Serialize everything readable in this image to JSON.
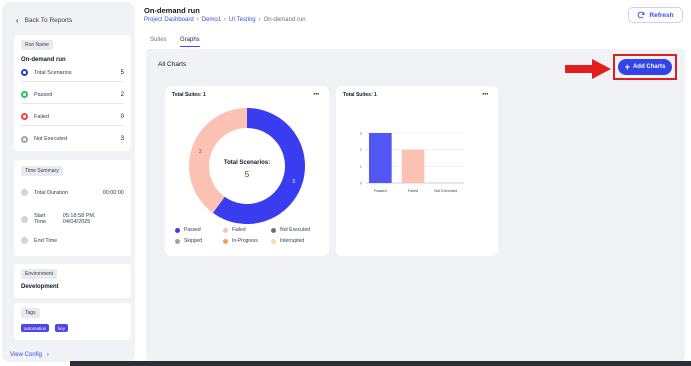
{
  "sidebar": {
    "back_label": "Back To Reports",
    "run_name_chip": "Run Name",
    "run_name": "On-demand run",
    "stats": [
      {
        "label": "Total Scenarios",
        "count": "5",
        "color": "#2b3bd6"
      },
      {
        "label": "Passed",
        "count": "2",
        "color": "#22c55e"
      },
      {
        "label": "Failed",
        "count": "0",
        "color": "#ef4444"
      },
      {
        "label": "Not Executed",
        "count": "3",
        "color": "#9ca3af"
      }
    ],
    "time_chip": "Time Summary",
    "times": [
      {
        "label": "Total Duration",
        "value": "00:00:00"
      },
      {
        "label": "Start Time",
        "value": "05:18:58 PM, 04/04/2025"
      },
      {
        "label": "End Time",
        "value": ""
      }
    ],
    "env_chip": "Environment",
    "env_value": "Development",
    "tags_chip": "Tags",
    "tags": [
      "automation",
      "key"
    ],
    "view_config": "View Config"
  },
  "header": {
    "title": "On-demand run",
    "breadcrumbs": [
      "Project Dashboard",
      "Demo1",
      "UI Testing",
      "On-demand run"
    ],
    "refresh_label": "Refresh"
  },
  "tabs": [
    "Suites",
    "Graphs"
  ],
  "main": {
    "all_charts": "All Charts",
    "add_charts": "Add Charts"
  },
  "colors": {
    "passed": "#3a3cf0",
    "failed": "#fbc2b4",
    "not_executed": "#6b7280",
    "skipped": "#9ca3af",
    "in_progress": "#f59e5b",
    "interrupted": "#fcd9a5",
    "bar_passed": "#5156f5",
    "bar_failed": "#fbc2b4"
  },
  "chart_data": [
    {
      "type": "pie",
      "title": "Total Suites: 1",
      "center_label": "Total Scenarios:",
      "center_value": "5",
      "categories": [
        "Passed",
        "Failed",
        "Not Executed",
        "Skipped",
        "In-Progress",
        "Interrupted"
      ],
      "values": [
        3,
        2,
        0,
        0,
        0,
        0
      ],
      "slice_labels": [
        "3",
        "2"
      ],
      "legend_placement": "bottom"
    },
    {
      "type": "bar",
      "title": "Total Suites: 1",
      "categories": [
        "Passed",
        "Failed",
        "Not Executed"
      ],
      "values": [
        3,
        2,
        0
      ],
      "ylim": [
        0,
        3
      ],
      "yticks": [
        "0",
        "1",
        "2",
        "3"
      ],
      "grid": true
    }
  ]
}
